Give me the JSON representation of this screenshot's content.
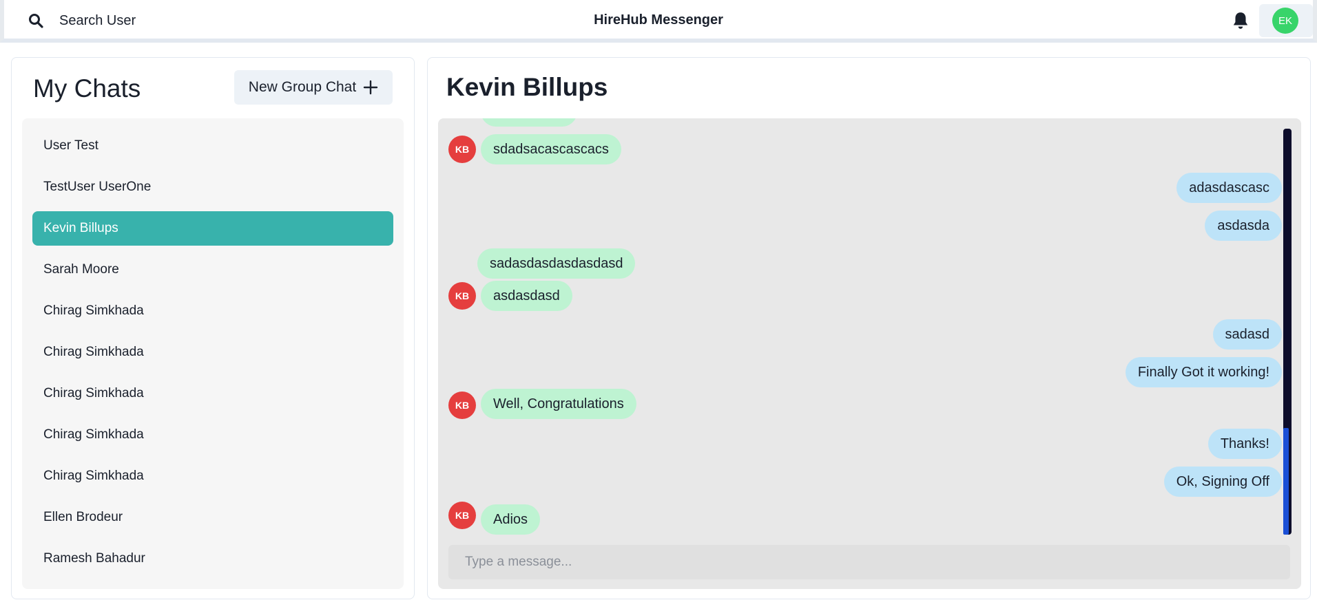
{
  "header": {
    "search_label": "Search User",
    "app_title": "HireHub Messenger",
    "user_initials": "EK",
    "search_icon": "search-icon",
    "bell_icon": "bell-icon"
  },
  "sidebar": {
    "title": "My Chats",
    "new_group_label": "New Group Chat",
    "chats": [
      {
        "name": "User Test",
        "active": false
      },
      {
        "name": "TestUser UserOne",
        "active": false
      },
      {
        "name": "Kevin Billups",
        "active": true
      },
      {
        "name": "Sarah Moore",
        "active": false
      },
      {
        "name": "Chirag Simkhada",
        "active": false
      },
      {
        "name": "Chirag Simkhada",
        "active": false
      },
      {
        "name": "Chirag Simkhada",
        "active": false
      },
      {
        "name": "Chirag Simkhada",
        "active": false
      },
      {
        "name": "Chirag Simkhada",
        "active": false
      },
      {
        "name": "Ellen Brodeur",
        "active": false
      },
      {
        "name": "Ramesh Bahadur",
        "active": false
      }
    ]
  },
  "chat": {
    "title": "Kevin Billups",
    "sender_initials": "KB",
    "messages": [
      {
        "text": "sdadsacascascacs",
        "from": "them",
        "avatar": true
      },
      {
        "text": "adasdascasc",
        "from": "me"
      },
      {
        "text": "asdasda",
        "from": "me"
      },
      {
        "text": "sadasdasdasdasdasd",
        "from": "them",
        "avatar": false
      },
      {
        "text": "asdasdasd",
        "from": "them",
        "avatar": true
      },
      {
        "text": "sadasd",
        "from": "me"
      },
      {
        "text": "Finally Got it working!",
        "from": "me"
      },
      {
        "text": "Well, Congratulations",
        "from": "them",
        "avatar": true
      },
      {
        "text": "Thanks!",
        "from": "me"
      },
      {
        "text": "Ok, Signing Off",
        "from": "me"
      },
      {
        "text": "Adios",
        "from": "them",
        "avatar": true
      }
    ],
    "input_placeholder": "Type a message..."
  },
  "colors": {
    "active_chat": "#38b2ac",
    "incoming_bubble": "#bef3d2",
    "outgoing_bubble": "#bde3f8",
    "sender_avatar": "#e53e3e",
    "user_avatar": "#38d46a"
  }
}
